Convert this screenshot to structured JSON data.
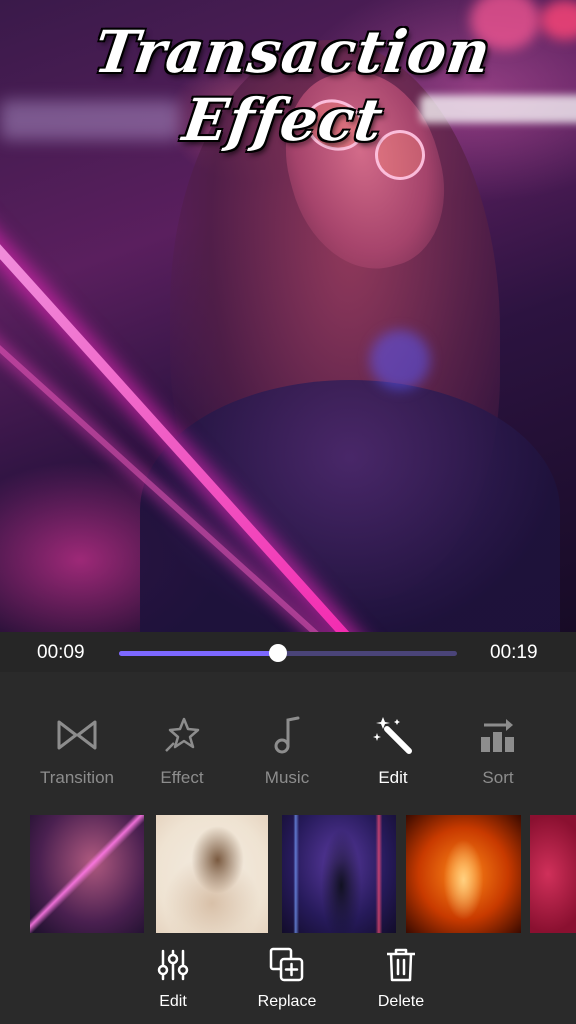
{
  "preview": {
    "title": "Transaction Effect"
  },
  "timeline": {
    "current_time": "00:09",
    "total_time": "00:19",
    "progress": 0.47
  },
  "tools": [
    {
      "label": "Transition",
      "icon": "transition-icon",
      "active": false
    },
    {
      "label": "Effect",
      "icon": "effect-star-icon",
      "active": false
    },
    {
      "label": "Music",
      "icon": "music-note-icon",
      "active": false
    },
    {
      "label": "Edit",
      "icon": "magic-wand-icon",
      "active": true
    },
    {
      "label": "Sort",
      "icon": "sort-icon",
      "active": false
    }
  ],
  "thumbnails": [
    {
      "name": "neon-portrait"
    },
    {
      "name": "sketch-portrait"
    },
    {
      "name": "neon-hallway"
    },
    {
      "name": "fire-portrait"
    },
    {
      "name": "pink-hearts"
    }
  ],
  "actions": [
    {
      "label": "Edit",
      "icon": "sliders-icon"
    },
    {
      "label": "Replace",
      "icon": "replace-icon"
    },
    {
      "label": "Delete",
      "icon": "trash-icon"
    }
  ],
  "colors": {
    "accent": "#7d68ff",
    "track": "#4a4478",
    "background": "#2a2a2a",
    "inactive_label": "#8d8d8d"
  }
}
